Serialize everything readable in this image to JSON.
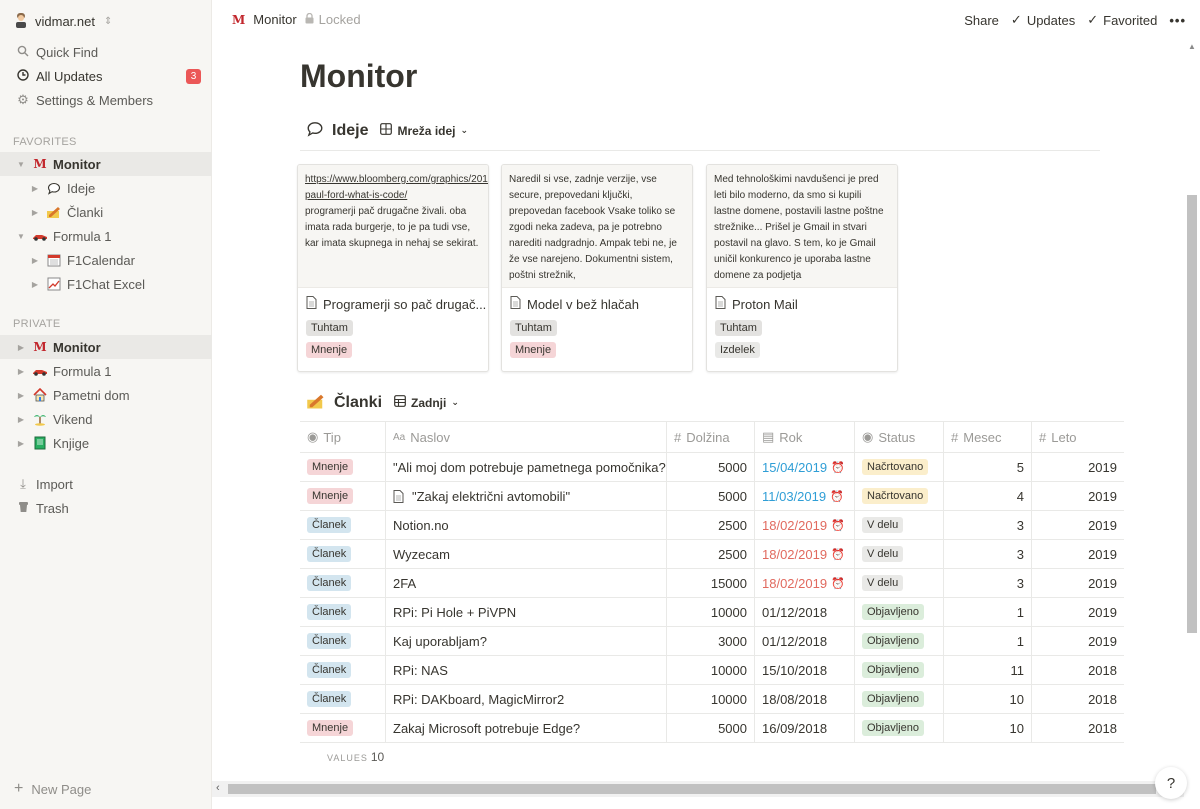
{
  "sidebar": {
    "workspace": "vidmar.net",
    "quick_find": "Quick Find",
    "all_updates": "All Updates",
    "updates_count": "3",
    "settings": "Settings & Members",
    "favorites_heading": "FAVORITES",
    "private_heading": "PRIVATE",
    "favorites": [
      {
        "label": "Monitor"
      },
      {
        "label": "Ideje"
      },
      {
        "label": "Članki"
      },
      {
        "label": "Formula 1"
      },
      {
        "label": "F1Calendar"
      },
      {
        "label": "F1Chat Excel"
      }
    ],
    "private": [
      {
        "label": "Monitor"
      },
      {
        "label": "Formula 1"
      },
      {
        "label": "Pametni dom"
      },
      {
        "label": "Vikend"
      },
      {
        "label": "Knjige"
      }
    ],
    "import": "Import",
    "trash": "Trash",
    "new_page": "New Page"
  },
  "topbar": {
    "page": "Monitor",
    "locked": "Locked",
    "share": "Share",
    "updates": "Updates",
    "favorited": "Favorited",
    "more": "•••"
  },
  "page": {
    "title": "Monitor",
    "ideje": {
      "heading": "Ideje",
      "view": "Mreža idej",
      "cards": [
        {
          "preview_link": "https://www.bloomberg.com/graphics/2015-paul-ford-what-is-code/",
          "preview": "programerji pač drugačne živali. oba imata rada burgerje, to je pa tudi vse, kar imata skupnega in nehaj se sekirat.",
          "title": "Programerji so pač drugač...",
          "tags": [
            "Tuhtam",
            "Mnenje"
          ]
        },
        {
          "preview_link": "",
          "preview": "Naredil si vse, zadnje verzije, vse secure, prepovedani ključki, prepovedan facebook Vsake toliko se zgodi neka zadeva, pa je potrebno narediti nadgradnjo. Ampak tebi ne, je že vse narejeno. Dokumentni sistem, poštni strežnik,",
          "title": "Model v bež hlačah",
          "tags": [
            "Tuhtam",
            "Mnenje"
          ]
        },
        {
          "preview_link": "",
          "preview": "Med tehnološkimi navdušenci je pred leti bilo moderno, da smo si kupili lastne domene, postavili lastne poštne strežnike... Prišel je Gmail in stvari postavil na glavo. S tem, ko je Gmail uničil konkurenco je uporaba lastne domene za podjetja",
          "title": "Proton Mail",
          "tags": [
            "Tuhtam",
            "Izdelek"
          ]
        }
      ]
    },
    "clanki": {
      "heading": "Članki",
      "view": "Zadnji",
      "columns": [
        "Tip",
        "Naslov",
        "Dolžina",
        "Rok",
        "Status",
        "Mesec",
        "Leto"
      ],
      "rows": [
        {
          "tip": "Mnenje",
          "naslov": "\"Ali moj dom potrebuje pametnega pomočnika?\"",
          "doc": false,
          "dolzina": "5000",
          "rok": "15/04/2019",
          "rok_state": "blue",
          "status": "Načrtovano",
          "mesec": "5",
          "leto": "2019"
        },
        {
          "tip": "Mnenje",
          "naslov": "\"Zakaj električni avtomobili\"",
          "doc": true,
          "dolzina": "5000",
          "rok": "11/03/2019",
          "rok_state": "blue",
          "status": "Načrtovano",
          "mesec": "4",
          "leto": "2019"
        },
        {
          "tip": "Članek",
          "naslov": "Notion.no",
          "doc": false,
          "dolzina": "2500",
          "rok": "18/02/2019",
          "rok_state": "red",
          "status": "V delu",
          "mesec": "3",
          "leto": "2019"
        },
        {
          "tip": "Članek",
          "naslov": "Wyzecam",
          "doc": false,
          "dolzina": "2500",
          "rok": "18/02/2019",
          "rok_state": "red",
          "status": "V delu",
          "mesec": "3",
          "leto": "2019"
        },
        {
          "tip": "Članek",
          "naslov": "2FA",
          "doc": false,
          "dolzina": "15000",
          "rok": "18/02/2019",
          "rok_state": "red",
          "status": "V delu",
          "mesec": "3",
          "leto": "2019"
        },
        {
          "tip": "Članek",
          "naslov": "RPi: Pi Hole + PiVPN",
          "doc": false,
          "dolzina": "10000",
          "rok": "01/12/2018",
          "rok_state": "plain",
          "status": "Objavljeno",
          "mesec": "1",
          "leto": "2019"
        },
        {
          "tip": "Članek",
          "naslov": "Kaj uporabljam?",
          "doc": false,
          "dolzina": "3000",
          "rok": "01/12/2018",
          "rok_state": "plain",
          "status": "Objavljeno",
          "mesec": "1",
          "leto": "2019"
        },
        {
          "tip": "Članek",
          "naslov": "RPi: NAS",
          "doc": false,
          "dolzina": "10000",
          "rok": "15/10/2018",
          "rok_state": "plain",
          "status": "Objavljeno",
          "mesec": "11",
          "leto": "2018"
        },
        {
          "tip": "Članek",
          "naslov": "RPi: DAKboard, MagicMirror2",
          "doc": false,
          "dolzina": "10000",
          "rok": "18/08/2018",
          "rok_state": "plain",
          "status": "Objavljeno",
          "mesec": "10",
          "leto": "2018"
        },
        {
          "tip": "Mnenje",
          "naslov": "Zakaj Microsoft potrebuje Edge?",
          "doc": false,
          "dolzina": "5000",
          "rok": "16/09/2018",
          "rok_state": "plain",
          "status": "Objavljeno",
          "mesec": "10",
          "leto": "2018"
        }
      ],
      "values_label": "VALUES",
      "values_count": "10"
    },
    "colors": {
      "accent_red": "#eb5757",
      "date_blue": "#2f9ed6",
      "date_red": "#e16a5f"
    }
  }
}
